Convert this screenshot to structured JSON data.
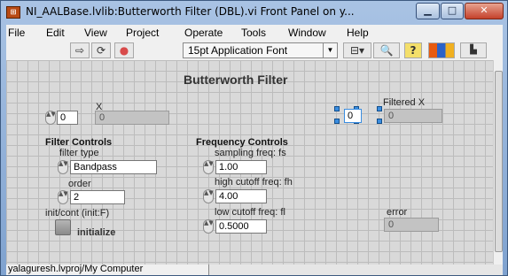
{
  "window": {
    "title": "NI_AALBase.lvlib:Butterworth Filter (DBL).vi Front Panel on y...",
    "icon": "labview-icon"
  },
  "menu": [
    "File",
    "Edit",
    "View",
    "Project",
    "Operate",
    "Tools",
    "Window",
    "Help"
  ],
  "toolbar": {
    "font_select": "15pt Application Font"
  },
  "panel": {
    "title": "Butterworth Filter",
    "x": {
      "label": "X",
      "index": "0",
      "value": "0"
    },
    "filtered_x": {
      "label": "Filtered X",
      "index": "0",
      "value": "0"
    },
    "filter_controls": {
      "heading": "Filter Controls",
      "filter_type_label": "filter type",
      "filter_type_value": "Bandpass",
      "order_label": "order",
      "order_value": "2",
      "init_label": "init/cont (init:F)",
      "init_button_label": "initialize"
    },
    "frequency_controls": {
      "heading": "Frequency Controls",
      "fs_label": "sampling freq: fs",
      "fs_value": "1.00",
      "fh_label": "high cutoff freq: fh",
      "fh_value": "4.00",
      "fl_label": "low cutoff freq: fl",
      "fl_value": "0.5000"
    },
    "error": {
      "label": "error",
      "value": "0"
    }
  },
  "status": {
    "context": "yalaguresh.lvproj/My Computer"
  }
}
